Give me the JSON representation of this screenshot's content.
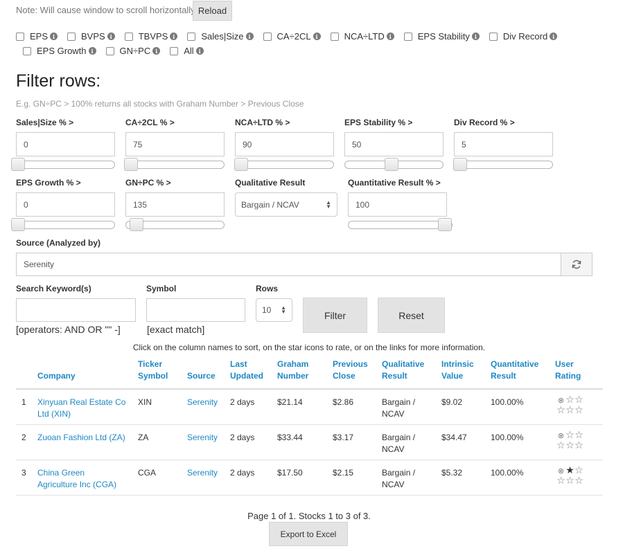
{
  "top": {
    "note": "Note: Will cause window to scroll horizontally",
    "reload_label": "Reload"
  },
  "toggles": {
    "row1": [
      "EPS",
      "BVPS",
      "TBVPS",
      "Sales|Size",
      "CA÷2CL",
      "NCA÷LTD",
      "EPS Stability",
      "Div Record"
    ],
    "row2": [
      "EPS Growth",
      "GN÷PC",
      "All"
    ]
  },
  "filter": {
    "title": "Filter rows:",
    "hint": "E.g. GN÷PC > 100% returns all stocks with Graham Number > Previous Close",
    "fields_row1": [
      {
        "label": "Sales|Size % >",
        "value": "0",
        "slider": 0.0
      },
      {
        "label": "CA÷2CL % >",
        "value": "75",
        "slider": 0.04
      },
      {
        "label": "NCA÷LTD % >",
        "value": "90",
        "slider": 0.05
      },
      {
        "label": "EPS Stability % >",
        "value": "50",
        "slider": 0.5
      },
      {
        "label": "Div Record % >",
        "value": "5",
        "slider": 0.05
      }
    ],
    "fields_row2": [
      {
        "label": "EPS Growth % >",
        "value": "0",
        "slider": 0.0
      },
      {
        "label": "GN÷PC % >",
        "value": "135",
        "slider": 0.1
      }
    ],
    "qualitative": {
      "label": "Qualitative Result",
      "value": "Bargain / NCAV"
    },
    "quantitative": {
      "label": "Quantitative Result % >",
      "value": "100",
      "slider": 1.0
    },
    "source": {
      "label": "Source (Analyzed by)",
      "value": "Serenity"
    },
    "keyword": {
      "label": "Search Keyword(s)",
      "value": "",
      "hint": "[operators: AND OR \"\" -]"
    },
    "symbol": {
      "label": "Symbol",
      "value": "",
      "hint": "[exact match]"
    },
    "rows": {
      "label": "Rows",
      "value": "10"
    },
    "filter_label": "Filter",
    "reset_label": "Reset"
  },
  "table": {
    "click_hint": "Click on the column names to sort, on the star icons to rate, or on the links for more information.",
    "headers": {
      "company": "Company",
      "ticker_1": "Ticker",
      "ticker_2": "Symbol",
      "source": "Source",
      "last_1": "Last",
      "last_2": "Updated",
      "graham_1": "Graham",
      "graham_2": "Number",
      "prev_1": "Previous",
      "prev_2": "Close",
      "qual_1": "Qualitative",
      "qual_2": "Result",
      "intr_1": "Intrinsic",
      "intr_2": "Value",
      "quant_1": "Quantitative",
      "quant_2": "Result",
      "user_1": "User",
      "user_2": "Rating"
    },
    "rows": [
      {
        "n": "1",
        "company_1": "Xinyuan Real Estate Co",
        "company_2": "Ltd (XIN)",
        "ticker": "XIN",
        "source": "Serenity",
        "updated": "2 days",
        "graham": "$21.14",
        "prev": "$2.86",
        "qual_1": "Bargain /",
        "qual_2": "NCAV",
        "intrinsic": "$9.02",
        "quant": "100.00%",
        "rating": 0
      },
      {
        "n": "2",
        "company_1": "Zuoan Fashion Ltd (ZA)",
        "company_2": "",
        "ticker": "ZA",
        "source": "Serenity",
        "updated": "2 days",
        "graham": "$33.44",
        "prev": "$3.17",
        "qual_1": "Bargain /",
        "qual_2": "NCAV",
        "intrinsic": "$34.47",
        "quant": "100.00%",
        "rating": 0
      },
      {
        "n": "3",
        "company_1": "China Green",
        "company_2": "Agriculture Inc (CGA)",
        "ticker": "CGA",
        "source": "Serenity",
        "updated": "2 days",
        "graham": "$17.50",
        "prev": "$2.15",
        "qual_1": "Bargain /",
        "qual_2": "NCAV",
        "intrinsic": "$5.32",
        "quant": "100.00%",
        "rating": 1
      }
    ],
    "pager": "Page 1 of 1. Stocks 1 to 3 of 3.",
    "export_label": "Export to Excel"
  }
}
